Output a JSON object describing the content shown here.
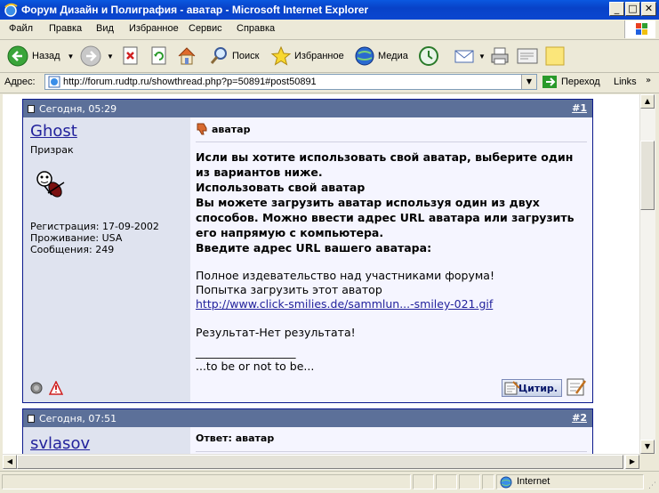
{
  "window": {
    "title": "Форум Дизайн и Полиграфия - аватар - Microsoft Internet Explorer",
    "minimize": "_",
    "maximize": "□",
    "close": "✕"
  },
  "menu": [
    "Файл",
    "Правка",
    "Вид",
    "Избранное",
    "Сервис",
    "Справка"
  ],
  "toolbar": {
    "back": "Назад",
    "search": "Поиск",
    "favorites": "Избранное",
    "media": "Медиа"
  },
  "address": {
    "label": "Адрес:",
    "url": "http://forum.rudtp.ru/showthread.php?p=50891#post50891",
    "go": "Переход",
    "links": "Links"
  },
  "posts": [
    {
      "date": "Сегодня, 05:29",
      "number": "#1",
      "username": "Ghost",
      "usertitle": "Призрак",
      "info": [
        "Регистрация: 17-09-2002",
        "Проживание: USA",
        "Сообщения: 249"
      ],
      "title": "аватар",
      "body_bold": [
        "Исли вы хотите использовать свой аватар, выберите один из вариантов ниже.",
        "Использовать свой аватар",
        "Вы можете загрузить аватар используя один из двух способов. Можно ввести адрес URL аватара или загрузить его напрямую с компьютера.",
        "Введите адрес URL вашего аватара:"
      ],
      "body_plain": [
        "Полное издевательство над участниками форума!",
        "Попытка загрузить этот аватор"
      ],
      "link": "http://www.click-smilies.de/sammlun...-smiley-021.gif",
      "result": "Результат-Нет результата!",
      "sig_line": "__________________",
      "signature": "...to be or not to be...",
      "quote_label": "Цитир."
    },
    {
      "date": "Сегодня, 07:51",
      "number": "#2",
      "username": "svlasov",
      "title": "Ответ: аватар"
    }
  ],
  "status": {
    "zone": "Internet"
  },
  "colors": {
    "titlebar": "#0a46d0",
    "post_header": "#5c7099",
    "post_left": "#dfe3ef",
    "link": "#22229c"
  }
}
